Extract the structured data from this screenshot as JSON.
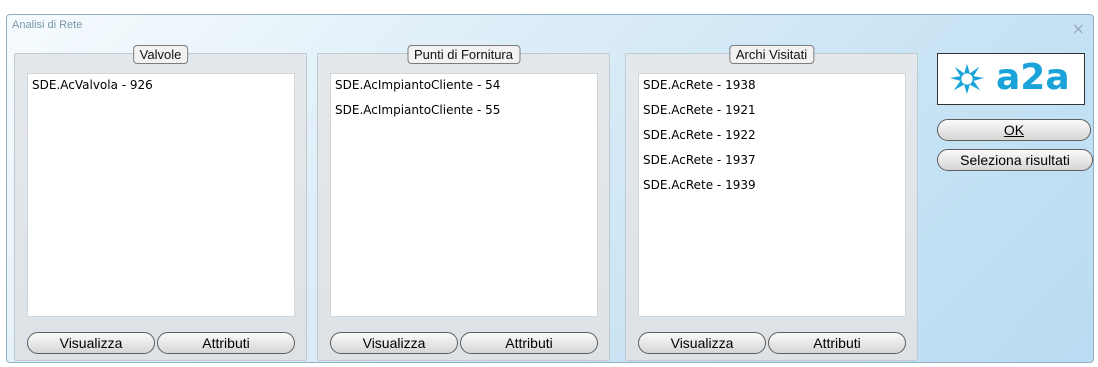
{
  "window": {
    "title": "Analisi di Rete",
    "close_symbol": "×"
  },
  "groups": [
    {
      "title": "Valvole",
      "items": [
        "SDE.AcValvola - 926"
      ],
      "visualizza_label": "Visualizza",
      "attributi_label": "Attributi"
    },
    {
      "title": "Punti di Fornitura",
      "items": [
        "SDE.AcImpiantoCliente - 54",
        "SDE.AcImpiantoCliente - 55"
      ],
      "visualizza_label": "Visualizza",
      "attributi_label": "Attributi"
    },
    {
      "title": "Archi Visitati",
      "items": [
        "SDE.AcRete - 1938",
        "SDE.AcRete - 1921",
        "SDE.AcRete - 1922",
        "SDE.AcRete - 1937",
        "SDE.AcRete - 1939"
      ],
      "visualizza_label": "Visualizza",
      "attributi_label": "Attributi"
    }
  ],
  "logo": {
    "text": "a2a",
    "icon": "a2a-logo-icon",
    "color": "#1aa3d8"
  },
  "actions": {
    "ok_label": "OK",
    "seleziona_label": "Seleziona risultati"
  }
}
